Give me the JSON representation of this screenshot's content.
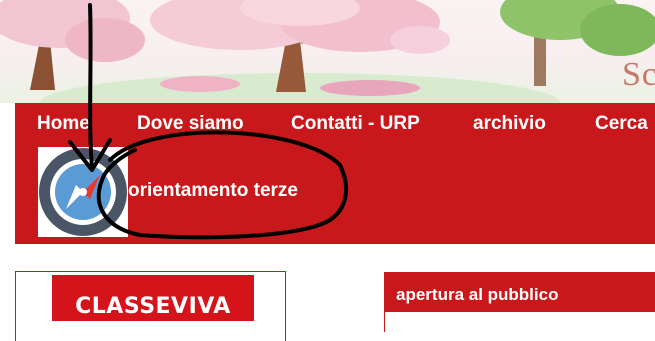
{
  "header": {
    "banner_text": "Sc"
  },
  "menu": {
    "items": [
      {
        "label": "Home"
      },
      {
        "label": "Dove siamo"
      },
      {
        "label": "Contatti - URP"
      },
      {
        "label": "archivio"
      },
      {
        "label": "Cerca"
      }
    ],
    "submenu_link": "orientamento terze",
    "compass_icon": "compass-icon"
  },
  "classeviva": {
    "logo_text": "CLASSEVIVA"
  },
  "sidebar": {
    "title": "apertura al pubblico"
  },
  "colors": {
    "nav_red": "#c8181b",
    "logo_red": "#d4141a",
    "annotation": "#000000"
  }
}
